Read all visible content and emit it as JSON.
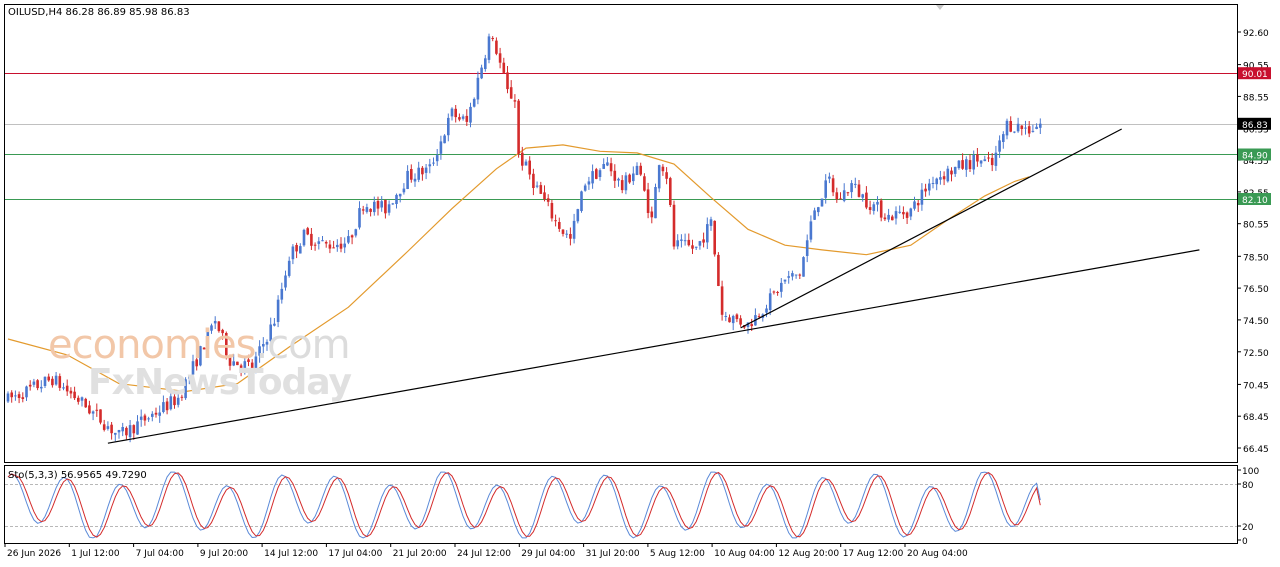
{
  "header": {
    "symbol": "OILUSD,H4",
    "ohlc": "86.28 86.89 85.98 86.83"
  },
  "oscillator": {
    "label": "Sto(5,3,3) 56.9565 49.7290",
    "ticks": [
      "100",
      "80",
      "20",
      "0"
    ]
  },
  "watermark": {
    "brand_part1": "economies",
    "brand_part2": ".com",
    "brand_line2": "FxNewsToday"
  },
  "colors": {
    "bull": "#4a78d0",
    "bear": "#d42b2b",
    "ma": "#e39a2d",
    "resistance": "#c8102e",
    "support": "#3a9a54",
    "current": "#000000",
    "sto_main": "#5b8ad8",
    "sto_signal": "#d42b2b"
  },
  "chart_data": {
    "type": "candlestick",
    "symbol": "OILUSD",
    "timeframe": "H4",
    "y_ticks": [
      "92.60",
      "90.55",
      "88.55",
      "86.53",
      "84.55",
      "82.55",
      "80.55",
      "78.50",
      "76.50",
      "74.50",
      "72.50",
      "70.45",
      "68.45",
      "66.45"
    ],
    "ylim": [
      66.45,
      93.5
    ],
    "x_tick_labels": [
      "26 Jun 2026",
      "1 Jul 12:00",
      "7 Jul 04:00",
      "9 Jul 20:00",
      "14 Jul 12:00",
      "17 Jul 04:00",
      "21 Jul 20:00",
      "24 Jul 12:00",
      "29 Jul 04:00",
      "31 Jul 20:00",
      "5 Aug 12:00",
      "10 Aug 04:00",
      "12 Aug 20:00",
      "17 Aug 12:00",
      "20 Aug 04:00"
    ],
    "levels": [
      {
        "value": 90.01,
        "label": "90.01",
        "kind": "resistance"
      },
      {
        "value": 86.83,
        "label": "86.83",
        "kind": "current"
      },
      {
        "value": 84.9,
        "label": "84.90",
        "kind": "support"
      },
      {
        "value": 82.1,
        "label": "82.10",
        "kind": "support"
      }
    ],
    "close_path": [
      [
        0,
        69.5
      ],
      [
        12,
        70.8
      ],
      [
        20,
        69.3
      ],
      [
        30,
        67.2
      ],
      [
        38,
        68.4
      ],
      [
        46,
        69.6
      ],
      [
        52,
        72.5
      ],
      [
        56,
        74.5
      ],
      [
        60,
        72.0
      ],
      [
        66,
        71.5
      ],
      [
        72,
        74.5
      ],
      [
        76,
        78.5
      ],
      [
        80,
        79.8
      ],
      [
        86,
        79.2
      ],
      [
        92,
        79.4
      ],
      [
        96,
        81.8
      ],
      [
        102,
        81.5
      ],
      [
        108,
        83.5
      ],
      [
        114,
        84.0
      ],
      [
        120,
        87.5
      ],
      [
        124,
        86.9
      ],
      [
        128,
        90.5
      ],
      [
        130,
        92.2
      ],
      [
        132,
        91.5
      ],
      [
        135,
        88.8
      ],
      [
        137,
        88.4
      ],
      [
        138,
        84.9
      ],
      [
        142,
        83.2
      ],
      [
        148,
        80.7
      ],
      [
        152,
        79.5
      ],
      [
        156,
        83.2
      ],
      [
        162,
        84.3
      ],
      [
        166,
        82.8
      ],
      [
        170,
        84.2
      ],
      [
        174,
        80.8
      ],
      [
        176,
        84.6
      ],
      [
        178,
        83.6
      ],
      [
        180,
        79.2
      ],
      [
        186,
        79.0
      ],
      [
        190,
        80.6
      ],
      [
        193,
        74.9
      ],
      [
        200,
        74.2
      ],
      [
        206,
        75.8
      ],
      [
        210,
        77.0
      ],
      [
        214,
        77.4
      ],
      [
        218,
        81.5
      ],
      [
        222,
        83.3
      ],
      [
        224,
        82.0
      ],
      [
        228,
        83.0
      ],
      [
        232,
        82.0
      ],
      [
        238,
        81.0
      ],
      [
        244,
        81.4
      ],
      [
        250,
        83.4
      ],
      [
        256,
        84.0
      ],
      [
        262,
        84.6
      ],
      [
        266,
        84.2
      ],
      [
        270,
        86.8
      ],
      [
        276,
        86.5
      ],
      [
        279,
        86.83
      ]
    ],
    "moving_average": [
      [
        0,
        73.3
      ],
      [
        16,
        72.3
      ],
      [
        30,
        70.5
      ],
      [
        48,
        70.0
      ],
      [
        62,
        70.5
      ],
      [
        76,
        72.8
      ],
      [
        92,
        75.3
      ],
      [
        108,
        78.8
      ],
      [
        120,
        81.5
      ],
      [
        132,
        84.0
      ],
      [
        140,
        85.3
      ],
      [
        150,
        85.5
      ],
      [
        160,
        85.1
      ],
      [
        170,
        85.0
      ],
      [
        180,
        84.3
      ],
      [
        190,
        82.2
      ],
      [
        200,
        80.2
      ],
      [
        210,
        79.2
      ],
      [
        220,
        78.9
      ],
      [
        232,
        78.6
      ],
      [
        244,
        79.2
      ],
      [
        254,
        80.8
      ],
      [
        264,
        82.3
      ],
      [
        272,
        83.2
      ],
      [
        276,
        83.5
      ]
    ],
    "trendlines": [
      {
        "from": [
          27,
          66.75
        ],
        "to": [
          322,
          78.9
        ]
      },
      {
        "from": [
          198,
          74.0
        ],
        "to": [
          301,
          86.5
        ]
      }
    ],
    "stochastic": {
      "name": "Sto(5,3,3)",
      "main": 56.9565,
      "signal": 49.729,
      "levels": [
        80,
        20
      ]
    }
  }
}
